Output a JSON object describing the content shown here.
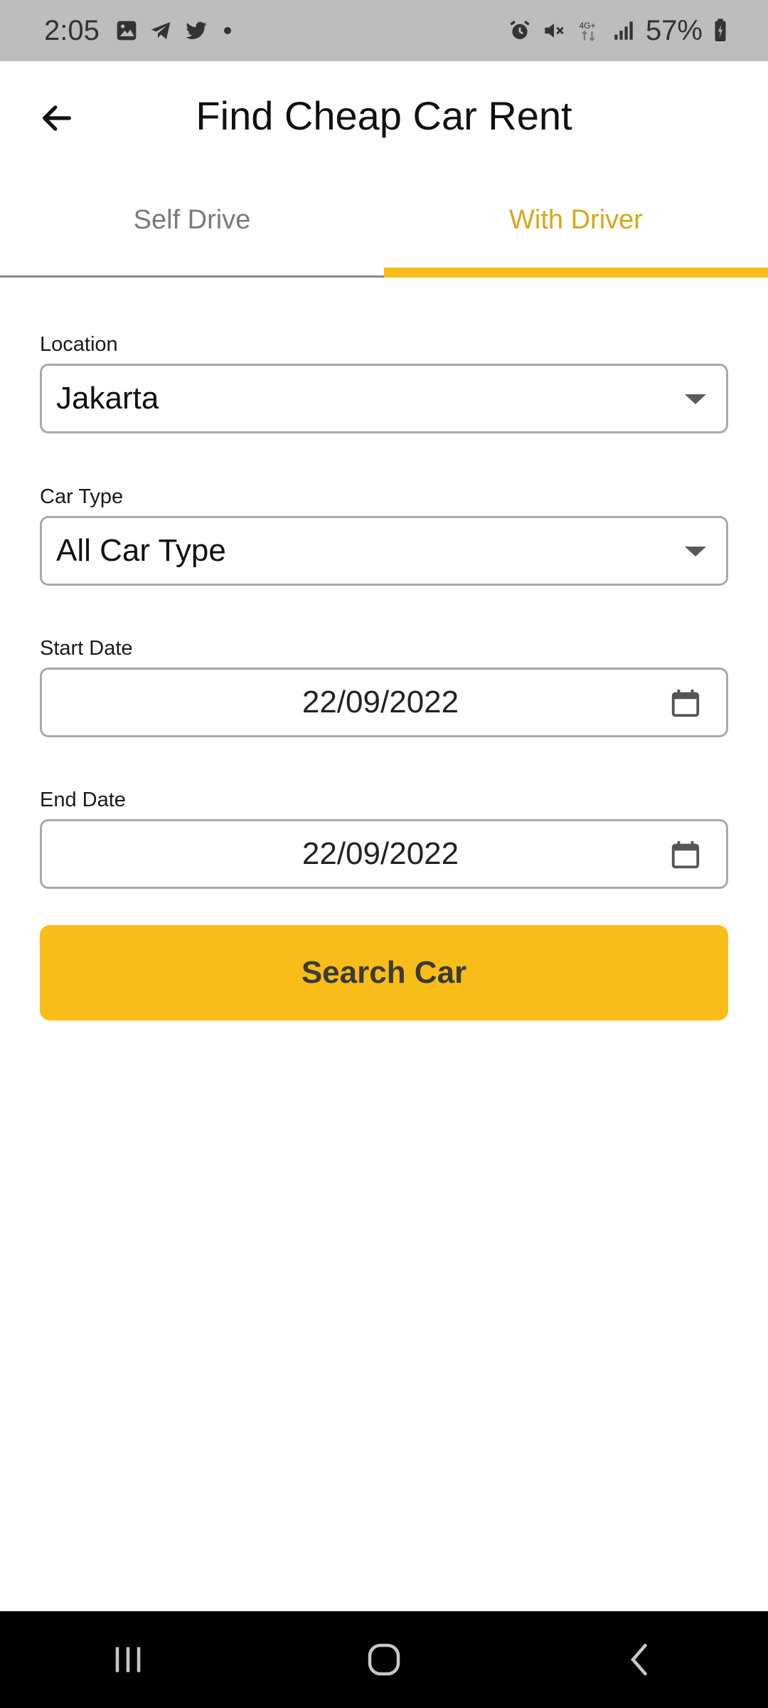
{
  "status_bar": {
    "time": "2:05",
    "battery": "57%",
    "network": "4G+",
    "icons_left": [
      "gallery-icon",
      "telegram-icon",
      "twitter-icon",
      "dot-icon"
    ],
    "icons_right": [
      "alarm-icon",
      "mute-icon",
      "network-4g-icon",
      "signal-icon",
      "battery-icon"
    ]
  },
  "app_bar": {
    "title": "Find Cheap Car Rent",
    "back_icon": "arrow-left-icon"
  },
  "tabs": [
    {
      "label": "Self Drive",
      "active": false
    },
    {
      "label": "With Driver",
      "active": true
    }
  ],
  "form": {
    "location": {
      "label": "Location",
      "value": "Jakarta"
    },
    "car_type": {
      "label": "Car Type",
      "value": "All Car Type"
    },
    "start_date": {
      "label": "Start Date",
      "value": "22/09/2022"
    },
    "end_date": {
      "label": "End Date",
      "value": "22/09/2022"
    },
    "search_label": "Search Car"
  },
  "nav": {
    "recents_icon": "recents-icon",
    "home_icon": "home-icon",
    "back_icon": "back-nav-icon"
  },
  "colors": {
    "accent": "#f8bd19",
    "accent_text": "#d9a616",
    "status_bar_bg": "#bdbdbd",
    "nav_bar_bg": "#000000"
  }
}
